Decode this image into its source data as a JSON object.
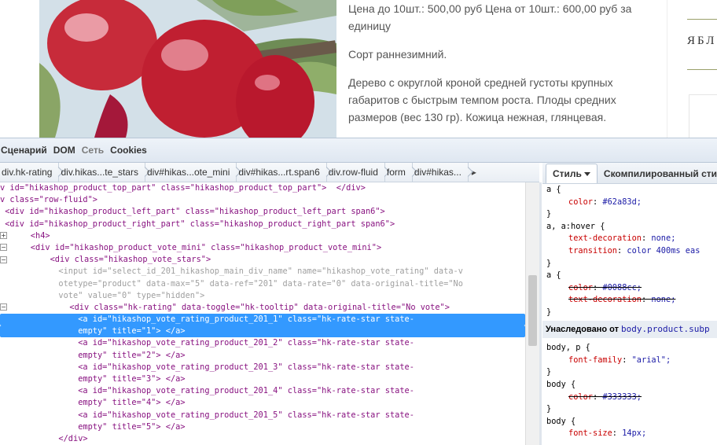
{
  "product": {
    "price_text": "Цена до 10шт.: 500,00 руб Цена от 10шт.: 600,00 руб за единицу",
    "sort_text": "Сорт раннезимний.",
    "description": "Дерево с округлой кроной средней густоты крупных габаритов с быстрым темпом роста. Плоды средних размеров (вес 130 гр). Кожица нежная, глянцевая.",
    "sidebar_title": "ЯБЛ"
  },
  "devtools": {
    "tabs": [
      "Сценарий",
      "DOM",
      "Сеть",
      "Cookies"
    ],
    "breadcrumbs": [
      "div.hk-rating",
      "div.hikas...te_stars",
      "div#hikas...ote_mini",
      "div#hikas...rt.span6",
      "div.row-fluid",
      "form",
      "div#hikas..."
    ],
    "breadcrumb_more": "▸",
    "style_tabs": {
      "style": "Стиль",
      "computed": "Скомпилированный стиль"
    },
    "dom_lines": [
      {
        "t": "v id=\"hikashop_product_top_part\" class=\"hikashop_product_top_part\">  </div>"
      },
      {
        "t": "v class=\"row-fluid\">"
      },
      {
        "t": " <div id=\"hikashop_product_left_part\" class=\"hikashop_product_left_part span6\">"
      },
      {
        "t": " <div id=\"hikashop_product_right_part\" class=\"hikashop_product_right_part span6\">"
      },
      {
        "t": "    <h4>"
      },
      {
        "t": "    <div id=\"hikashop_product_vote_mini\" class=\"hikashop_product_vote_mini\">"
      },
      {
        "t": "        <div class=\"hikashop_vote_stars\">"
      },
      {
        "t": "            <input id=\"select_id_201_hikashop_main_div_name\" name=\"hikashop_vote_rating\" data-v"
      },
      {
        "t": "            otetype=\"product\" data-max=\"5\" data-ref=\"201\" data-rate=\"0\" data-original-title=\"No"
      },
      {
        "t": "            vote\" value=\"0\" type=\"hidden\">"
      },
      {
        "t": "            <div class=\"hk-rating\" data-toggle=\"hk-tooltip\" data-original-title=\"No vote\">"
      },
      {
        "t": "                <a id=\"hikashop_vote_rating_product_201_1\" class=\"hk-rate-star state-"
      },
      {
        "t": "                empty\" title=\"1\"> </a>"
      },
      {
        "t": "                <a id=\"hikashop_vote_rating_product_201_2\" class=\"hk-rate-star state-"
      },
      {
        "t": "                empty\" title=\"2\"> </a>"
      },
      {
        "t": "                <a id=\"hikashop_vote_rating_product_201_3\" class=\"hk-rate-star state-"
      },
      {
        "t": "                empty\" title=\"3\"> </a>"
      },
      {
        "t": "                <a id=\"hikashop_vote_rating_product_201_4\" class=\"hk-rate-star state-"
      },
      {
        "t": "                empty\" title=\"4\"> </a>"
      },
      {
        "t": "                <a id=\"hikashop_vote_rating_product_201_5\" class=\"hk-rate-star state-"
      },
      {
        "t": "                empty\" title=\"5\"> </a>"
      },
      {
        "t": "            </div>"
      }
    ],
    "styles": {
      "r1_sel": "a {",
      "r1_p1n": "color",
      "r1_p1v": "#62a83d;",
      "close": "}",
      "r2_sel": "a, a:hover {",
      "r2_p1n": "text-decoration",
      "r2_p1v": "none;",
      "r2_p2n": "transition",
      "r2_p2v": "color 400ms eas",
      "r3_sel": "a {",
      "r3_p1n": "color",
      "r3_p1v": "#0088cc;",
      "r3_p2n": "text-decoration",
      "r3_p2v": "none;",
      "inherited_label": "Унаследовано от",
      "inherited_sel": "body.product.subp",
      "r4_sel": "body, p {",
      "r4_p1n": "font-family",
      "r4_p1v": "\"arial\";",
      "r5_sel": "body {",
      "r5_p1n": "color",
      "r5_p1v": "#333333;",
      "r6_sel": "body {",
      "r6_p1n": "font-size",
      "r6_p1v": "14px;"
    }
  }
}
